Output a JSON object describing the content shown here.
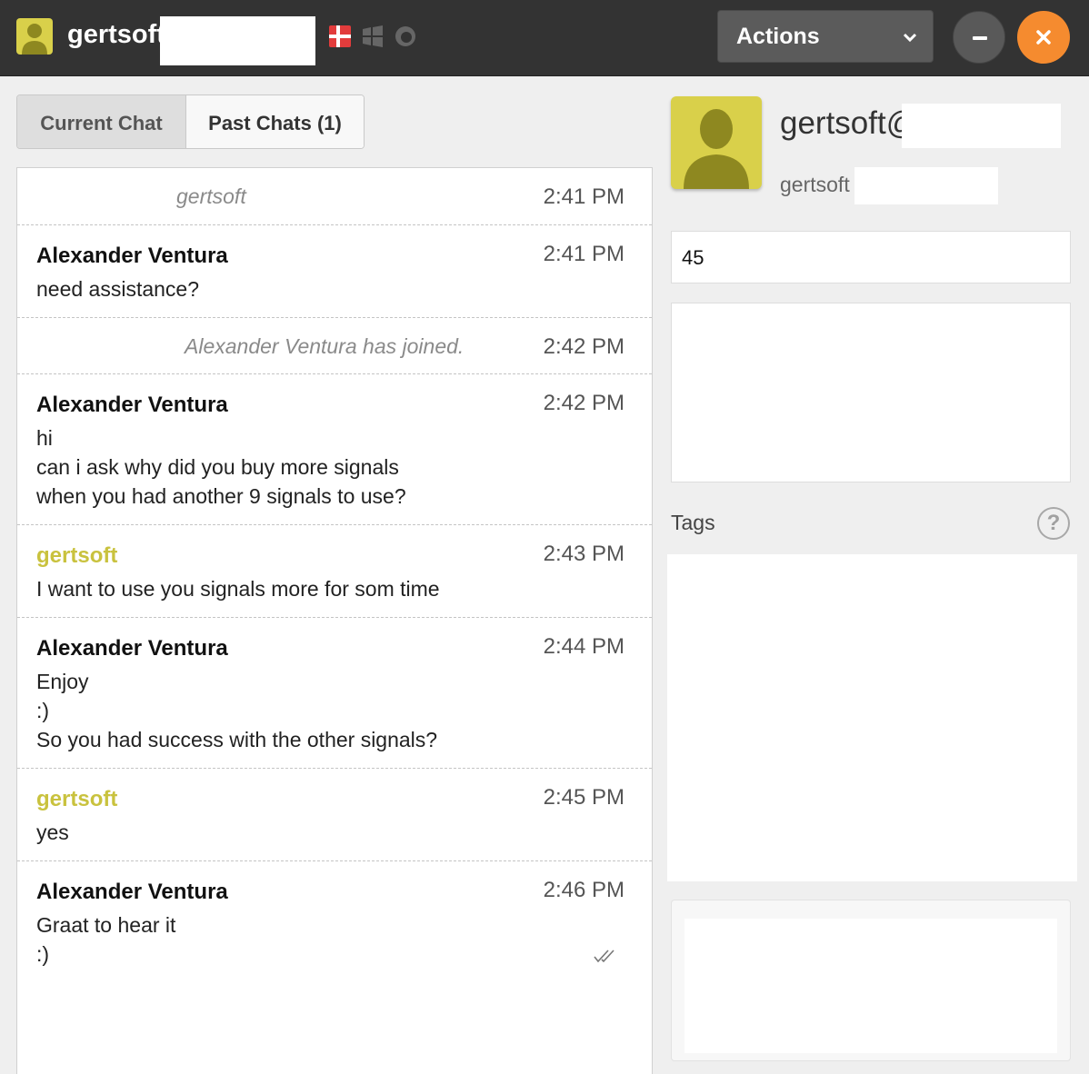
{
  "header": {
    "title": "gertsoft",
    "actions_label": "Actions"
  },
  "tabs": [
    {
      "label": "Current Chat",
      "active": true
    },
    {
      "label": "Past Chats (1)",
      "active": false
    }
  ],
  "messages": [
    {
      "system": "gertsoft",
      "time": "2:41 PM"
    },
    {
      "name": "Alexander Ventura",
      "time": "2:41 PM",
      "lines": [
        "need assistance?"
      ]
    },
    {
      "system": "Alexander Ventura has joined.",
      "time": "2:42 PM"
    },
    {
      "name": "Alexander Ventura",
      "time": "2:42 PM",
      "lines": [
        "hi",
        "can i ask why did you buy more signals",
        "when you had another 9 signals to use?"
      ]
    },
    {
      "name": "gertsoft",
      "time": "2:43 PM",
      "lines": [
        "I want to use you signals more for som time"
      ]
    },
    {
      "name": "Alexander Ventura",
      "time": "2:44 PM",
      "lines": [
        "Enjoy",
        ":)",
        "So you had success with the other signals?"
      ]
    },
    {
      "name": "gertsoft",
      "time": "2:45 PM",
      "lines": [
        "yes"
      ]
    },
    {
      "name": "Alexander Ventura",
      "time": "2:46 PM",
      "lines": [
        "Graat to hear it",
        ":)"
      ]
    }
  ],
  "visitor": {
    "name": "gertsoft@",
    "sub": "gertsoft",
    "field_value": "45",
    "tags_label": "Tags",
    "help_glyph": "?"
  },
  "colors": {
    "header_bg": "#333333",
    "accent_close": "#f58b2f",
    "visitor_name": "#c9c23e",
    "avatar": "#d9d04a"
  }
}
